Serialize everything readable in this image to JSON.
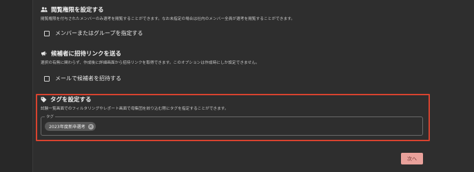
{
  "access": {
    "title": "閲覧権限を設定する",
    "description": "閲覧権限を付与されたメンバーのみ選考を閲覧することができます。なお未指定の場合は社内のメンバー全員が選考を閲覧することができます。",
    "checkbox_label": "メンバーまたはグループを指定する",
    "checked": false
  },
  "invite": {
    "title": "候補者に招待リンクを送る",
    "description": "選択の有無に関わらず、作成後に詳細画面から招待リンクを取得できます。このオプションは作成時にしか設定できません。",
    "checkbox_label": "メールで候補者を招待する",
    "checked": false
  },
  "tags": {
    "title": "タグを設定する",
    "description": "試験一覧画面でのフィルタリングやレポート画面で母集団を絞り込む際にタグを指定することができます。",
    "field_label": "タグ",
    "chips": [
      "2023年度新卒選考"
    ]
  },
  "footer": {
    "next_label": "次へ"
  },
  "colors": {
    "background": "#2e2e2e",
    "highlight": "#d9432f",
    "primary_button": "#e9a19b"
  },
  "icons": {
    "access": "people-icon",
    "invite": "megaphone-icon",
    "tags": "tag-icon",
    "chip_delete": "close-circle-icon"
  }
}
